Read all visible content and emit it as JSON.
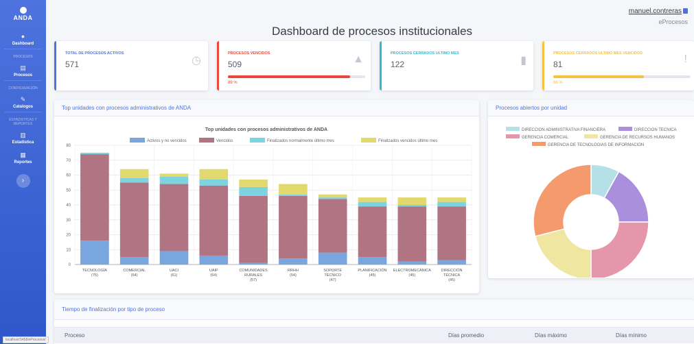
{
  "sidebar": {
    "logo_text": "ANDA",
    "items": [
      {
        "label": "Dashboard",
        "icon": "dashboard-icon"
      },
      {
        "label": "Procesos",
        "icon": "process-icon"
      },
      {
        "label": "Catalogos",
        "icon": "wrench-icon"
      },
      {
        "label": "Estadistica",
        "icon": "stats-icon"
      },
      {
        "label": "Reportes",
        "icon": "report-icon"
      }
    ],
    "headings": [
      "PROCESOS",
      "CONFIGURACIÓN",
      "ESTADISTICAS Y REPORTES"
    ],
    "toggle_icon": "chevron-right-icon"
  },
  "topbar": {
    "username": "manuel.contreras",
    "app_name": "eProcesos"
  },
  "page_title": "Dashboard de procesos institucionales",
  "stats": [
    {
      "label": "TOTAL DE PROCESOS ACTIVOS",
      "value": "571",
      "color": "#4e73df",
      "icon": "clock-icon"
    },
    {
      "label": "PROCESOS VENCIDOS",
      "value": "509",
      "color": "#e74a3b",
      "icon": "warning-icon",
      "percent": "89 %",
      "fraction": 0.89
    },
    {
      "label": "PROCESOS CERRADOS ULTIMO MES",
      "value": "122",
      "color": "#36b9cc",
      "icon": "clipboard-icon"
    },
    {
      "label": "PROCESOS CERRADOS ULTIMO MES VENCIDOS",
      "value": "81",
      "color": "#f6c23e",
      "icon": "exclamation-icon",
      "percent": "66 %",
      "fraction": 0.66
    }
  ],
  "bar_panel": {
    "title": "Top unidades con procesos administrativos de ANDA"
  },
  "pie_panel": {
    "title": "Procesos abiertos por unidad"
  },
  "table_panel": {
    "title": "Tiempo de finalización por tipo de proceso",
    "columns": [
      "Proceso",
      "Días promedio",
      "Días máximo",
      "Días mínimo"
    ]
  },
  "status_url": "localhost:5458/eProcesos/",
  "chart_data": [
    {
      "type": "bar",
      "stacked": true,
      "title": "Top unidades con procesos administrativos de ANDA",
      "categories": [
        [
          "TECNOLOGÍA",
          "(75)"
        ],
        [
          "COMERCIAL",
          "(64)"
        ],
        [
          "UACI",
          "(61)"
        ],
        [
          "UAIP",
          "(64)"
        ],
        [
          "COMUNIDADES",
          "RURALES",
          "(57)"
        ],
        [
          "RRHH",
          "(54)"
        ],
        [
          "SOPORTE",
          "TÉCNICO",
          "(47)"
        ],
        [
          "PLANIFICACIÓN",
          "(45)"
        ],
        [
          "ELECTROMECÁNICA",
          "(45)"
        ],
        [
          "DIRECCIÓN",
          "TÉCNICA",
          "(45)"
        ]
      ],
      "series": [
        {
          "name": "Activos y no vencidos",
          "color": "#7aa6e0",
          "values": [
            16,
            5,
            9,
            6,
            1,
            4,
            8,
            5,
            2,
            3
          ]
        },
        {
          "name": "Vencidos",
          "color": "#b07482",
          "values": [
            58,
            50,
            45,
            47,
            45,
            42,
            36,
            34,
            37,
            36
          ]
        },
        {
          "name": "Finalizados normalmente último mes",
          "color": "#7dd3df",
          "values": [
            1,
            3,
            5,
            4,
            6,
            1,
            1,
            3,
            1,
            3
          ]
        },
        {
          "name": "Finalizados vencidos último mes",
          "color": "#e2d96e",
          "values": [
            0,
            6,
            2,
            7,
            5,
            7,
            2,
            3,
            5,
            3
          ]
        }
      ],
      "ylim": [
        0,
        80
      ],
      "yticks": [
        0,
        10,
        20,
        30,
        40,
        50,
        60,
        70,
        80
      ],
      "legend": "top",
      "grid": true
    },
    {
      "type": "pie",
      "donut": true,
      "labels": [
        "DIRECCION ADMINISTRATIVA FINANCIERA",
        "DIRECCION TECNICA",
        "GERENCIA COMERCIAL",
        "GERENCIA DE RECURSOS HUMANOS",
        "GERENCIA DE TECNOLOGIAS DE INFORMACION"
      ],
      "colors": [
        "#b6e0e8",
        "#a98fdc",
        "#e596aa",
        "#efe6a2",
        "#f59a6c"
      ],
      "values": [
        8,
        17,
        25,
        21,
        29
      ],
      "legend": "top"
    }
  ]
}
